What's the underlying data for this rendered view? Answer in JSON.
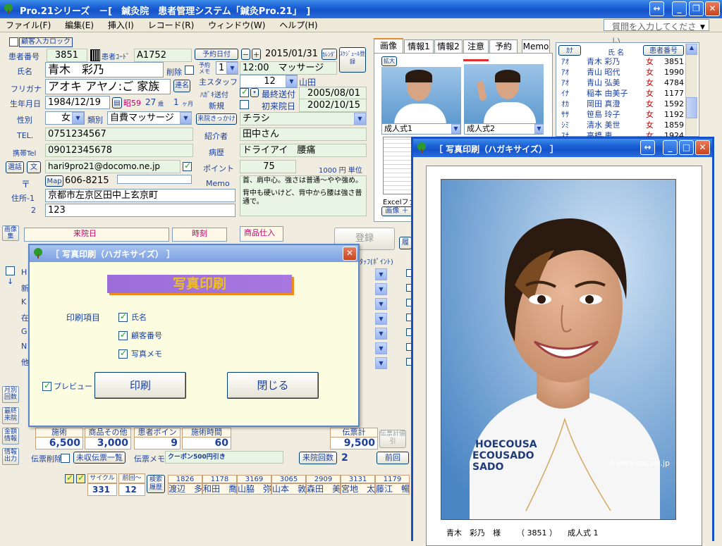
{
  "app": {
    "title": "Pro.21シリーズ　－[　鍼灸院　患者管理システム「鍼灸Pro.21」　]",
    "help_placeholder": "質問を入力してください"
  },
  "menu": [
    "ファイル(F)",
    "編集(E)",
    "挿入(I)",
    "レコード(R)",
    "ウィンドウ(W)",
    "ヘルプ(H)"
  ],
  "patient": {
    "carousel_label": "顧客入カロック",
    "id_label": "患者番号",
    "id": "3851",
    "code_label": "患者ｺｰﾄﾞ",
    "code": "A1752",
    "name_label": "氏名",
    "name": "青木　彩乃",
    "delete_label": "削除",
    "kana_label": "フリガナ",
    "kana": "アオキ アヤノ:ご 家族",
    "family_btn": "連名",
    "birth_label": "生年月日",
    "birth": "1984/12/19",
    "era": "昭59",
    "age": "27",
    "age_unit": "歳",
    "months": "1",
    "months_unit": "ヶ月",
    "sex_label": "性別",
    "sex": "女",
    "type_label": "類別",
    "type": "自費マッサージ",
    "tel_label": "TEL.",
    "tel": "0751234567",
    "mobile_label": "携帯Tel",
    "mobile": "09012345678",
    "email": "hari9pro21@docomo.ne.jp",
    "zip_symbol": "〒",
    "map_btn": "Map",
    "zip": "606-8215",
    "addr1_label": "住所-1",
    "addr1": "京都市左京区田中上玄京町",
    "addr2_label": "2",
    "addr2": "123",
    "select_btn": "選話",
    "letter_btn": "文"
  },
  "mid": {
    "reserve_btn": "予約日付",
    "date": "2015/01/31",
    "calendar_btn": "ｶﾚﾝﾀﾞ",
    "schedule_btn": "ｽｹｼﾞｭｰﾙ登録",
    "reserve_memo_label": "予約メモ",
    "reserve_num": "1",
    "reserve_memo": "12:00　マッサージ",
    "staff_label": "主スタッフ",
    "staff_num": "12",
    "staff_name": "山田",
    "hagaki_label": "ﾊｶﾞｷ送付",
    "last_sent_label": "最終送付",
    "last_sent": "2005/08/01",
    "new_label": "新規",
    "first_visit_label": "初来院日",
    "first_visit": "2002/10/15",
    "reason_btn": "来院きっかけ",
    "reason": "チラシ",
    "referrer_label": "紹介者",
    "referrer": "田中さん",
    "history_label": "病歴",
    "history": "ドライアイ　腰痛",
    "point_label": "ポイント",
    "point": "75",
    "point_unit": "1000 円 単位",
    "memo_label": "Memo",
    "memo1": "首、肩中心。強さは普通～やや強め。",
    "memo2": "背中も硬いけど、背中から腰は強さ普通で。"
  },
  "tabs": [
    "画像",
    "情報1",
    "情報2",
    "注意",
    "予約",
    "Memo"
  ],
  "photos": {
    "enlarge": "拡大",
    "cap1": "成人式1",
    "cap2": "成人式2",
    "excel": "Excelファ",
    "image_btn": "画像 ＋"
  },
  "list": {
    "header": [
      "ｶﾅ",
      "氏 名",
      "患者番号"
    ],
    "rows": [
      [
        "ｱｵ",
        "青木 彩乃",
        "女",
        "3851"
      ],
      [
        "ｱｵ",
        "青山 昭代",
        "女",
        "1990"
      ],
      [
        "ｱｵ",
        "青山 弘美",
        "女",
        "4784"
      ],
      [
        "ｲﾅ",
        "稲本 由美子",
        "女",
        "1177"
      ],
      [
        "ｵｶ",
        "岡田 真澄",
        "女",
        "1592"
      ],
      [
        "ｻｻ",
        "笹島 玲子",
        "女",
        "1192"
      ],
      [
        "ｼﾐ",
        "清水 美世",
        "女",
        "1859"
      ],
      [
        "ｽﾅ",
        "高橋 恵",
        "女",
        "1924"
      ]
    ]
  },
  "visit": {
    "visit_label": "来院日",
    "time_label": "時刻",
    "goods_label": "商品仕入",
    "register_btn": "登録",
    "history_btn": "履",
    "staff_point_label": "ﾀｯﾌ(ﾎﾟｲﾝﾄ)",
    "row_letters": [
      "H",
      "新",
      "K",
      "在",
      "G",
      "N",
      "他"
    ]
  },
  "totals": {
    "treat_label": "施術",
    "treat": "6,500",
    "other_label": "商品その他",
    "other": "3,000",
    "pt_label": "患者ポイント",
    "pt": "9",
    "time_label": "施術時間",
    "time": "60",
    "slip_label": "伝票計",
    "slip": "9,500",
    "slip_discount": "伝票計値引",
    "slip_delete": "伝票削除",
    "slip_list": "未収伝票一覧",
    "slip_memo_label": "伝票メモ",
    "slip_memo": "クーポン500円引き",
    "visits_btn": "来院回数",
    "visits": "2",
    "prev_btn": "前回"
  },
  "bottom": {
    "cycle_label": "サイクル",
    "prev_label": "前回～",
    "cycle": "331",
    "prev": "12",
    "search_btn": "検索履歴",
    "nums": [
      "1826",
      "1178",
      "3169",
      "3065",
      "2909",
      "3131",
      "1179"
    ],
    "names": [
      "渡辺　多",
      "和田　喬",
      "山脇　弥",
      "山本　敦",
      "森田　美",
      "宮地　太",
      "藤江　暢"
    ]
  },
  "side": [
    "画像集",
    "月別回数",
    "最終来院",
    "金額情報",
    "情報出力"
  ],
  "dialog": {
    "title": "［ 写真印刷（ハガキサイズ） ］",
    "heading": "写真印刷",
    "items_label": "印刷項目",
    "opt_name": "氏名",
    "opt_number": "顧客番号",
    "opt_memo": "写真メモ",
    "preview": "プレビュー",
    "print_btn": "印刷",
    "close_btn": "閉じる"
  },
  "preview": {
    "title": "［ 写真印刷（ハガキサイズ） ］",
    "watermark": "©www.daj.ne.jp",
    "footer_name": "青木　彩乃　様",
    "footer_id": "（ 3851 ）",
    "footer_memo": "成人式 1",
    "shirt_text": [
      "HOECOUSA",
      "ECOUSADO",
      "SADO"
    ]
  }
}
